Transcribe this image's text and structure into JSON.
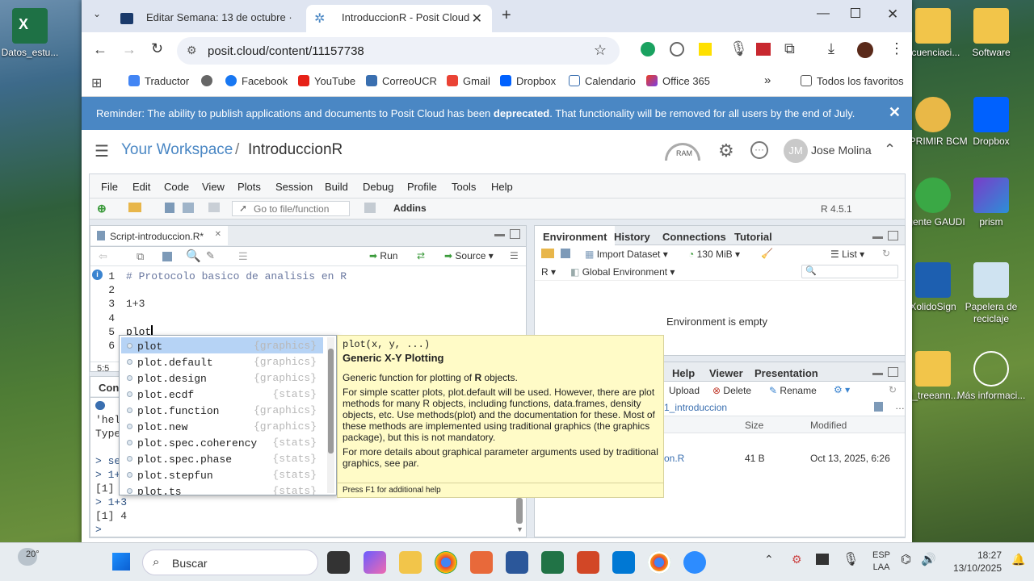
{
  "desktop": {
    "left_icons": [
      {
        "label": "Datos_estu..."
      }
    ],
    "right_icons": [
      {
        "label": "ecuenciaci..."
      },
      {
        "label": "Software"
      },
      {
        "label": "IMPRIMIR BCM"
      },
      {
        "label": "Dropbox"
      },
      {
        "label": "Agente GAUDI"
      },
      {
        "label": "prism"
      },
      {
        "label": "XolidoSign"
      },
      {
        "label": "Papelera de reciclaje"
      },
      {
        "label": "ti_treeann..."
      },
      {
        "label": "Más informaci..."
      }
    ]
  },
  "browser": {
    "tabs": [
      {
        "title": "Editar Semana: 13 de octubre ·"
      },
      {
        "title": "IntroduccionR - Posit Cloud"
      }
    ],
    "new_tab": "+",
    "url": "posit.cloud/content/11157738",
    "bookmarks": [
      "Traductor",
      "Facebook",
      "YouTube",
      "CorreoUCR",
      "Gmail",
      "Dropbox",
      "Calendario",
      "Office 365"
    ],
    "bookmarks_more": "»",
    "all_favorites": "Todos los favoritos",
    "colors": {
      "banner": "#4a87c4",
      "accent": "#4a87c4"
    }
  },
  "banner": {
    "text_before": "Reminder: The ability to publish applications and documents to Posit Cloud has been ",
    "bold": "deprecated",
    "text_after": ". That functionality will be removed for all users by the end of July.",
    "close": "✕"
  },
  "workspace": {
    "breadcrumb_workspace": "Your Workspace",
    "separator": "/",
    "project": "IntroduccionR",
    "ram_label": "RAM",
    "avatar_initials": "JM",
    "user_name": "Jose Molina"
  },
  "rstudio": {
    "menu": [
      "File",
      "Edit",
      "Code",
      "View",
      "Plots",
      "Session",
      "Build",
      "Debug",
      "Profile",
      "Tools",
      "Help"
    ],
    "goto_placeholder": "Go to file/function",
    "addins": "Addins",
    "r_version": "R 4.5.1",
    "editor": {
      "tab_title": "Script-introduccion.R*",
      "run": "Run",
      "source": "Source",
      "line_numbers": [
        "1",
        "2",
        "3",
        "4",
        "5",
        "6"
      ],
      "lines": [
        "# Protocolo basico de analisis en R",
        "",
        "1+3",
        "",
        "plot",
        ""
      ],
      "cursor_pos": "5:5"
    },
    "autocomplete": {
      "items": [
        {
          "name": "plot",
          "pkg": "{graphics}"
        },
        {
          "name": "plot.default",
          "pkg": "{graphics}"
        },
        {
          "name": "plot.design",
          "pkg": "{graphics}"
        },
        {
          "name": "plot.ecdf",
          "pkg": "{stats}"
        },
        {
          "name": "plot.function",
          "pkg": "{graphics}"
        },
        {
          "name": "plot.new",
          "pkg": "{graphics}"
        },
        {
          "name": "plot.spec.coherency",
          "pkg": "{stats}"
        },
        {
          "name": "plot.spec.phase",
          "pkg": "{stats}"
        },
        {
          "name": "plot.stepfun",
          "pkg": "{stats}"
        },
        {
          "name": "plot.ts",
          "pkg": "{stats}"
        }
      ]
    },
    "tooltip": {
      "signature": "plot(x, y, ...)",
      "title": "Generic X-Y Plotting",
      "p1_before": "Generic function for plotting of ",
      "p1_bold": "R",
      "p1_after": " objects.",
      "p2": "For simple scatter plots, plot.default will be used. However, there are plot methods for many R objects, including functions, data.frames, density objects, etc. Use methods(plot) and the documentation for these. Most of these methods are implemented using traditional graphics (the graphics package), but this is not mandatory.",
      "p3": "For more details about graphical parameter arguments used by traditional graphics, see par.",
      "footer": "Press F1 for additional help"
    },
    "console": {
      "tab_partial": "Cons",
      "lines_partial": [
        "'hel",
        "Type",
        "",
        "> se",
        "> 1+",
        "[1]",
        "> 1+3",
        "[1] 4",
        ">"
      ]
    },
    "env_pane": {
      "tabs": [
        "Environment",
        "History",
        "Connections",
        "Tutorial"
      ],
      "import_dataset": "Import Dataset",
      "memory": "130 MiB",
      "list_view": "List",
      "r_dropdown": "R",
      "global_env": "Global Environment",
      "empty_msg": "Environment is empty"
    },
    "files_pane": {
      "tabs_visible": [
        "Help",
        "Viewer",
        "Presentation"
      ],
      "upload": "Upload",
      "delete": "Delete",
      "rename": "Rename",
      "path_partial": "1_introduccion",
      "columns": [
        "Size",
        "Modified"
      ],
      "row": {
        "name_partial": "on.R",
        "size": "41 B",
        "modified": "Oct 13, 2025, 6:26"
      }
    }
  },
  "taskbar": {
    "weather": "20°",
    "search_placeholder": "Buscar",
    "lang_top": "ESP",
    "lang_bottom": "LAA",
    "time": "18:27",
    "date": "13/10/2025"
  }
}
